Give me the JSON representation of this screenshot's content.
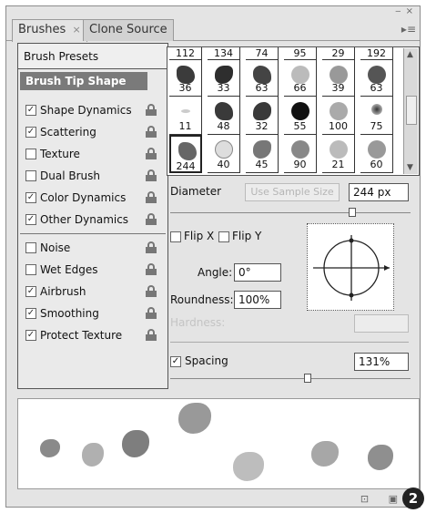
{
  "tabs": [
    {
      "label": "Brushes",
      "close": "×"
    },
    {
      "label": "Clone Source"
    }
  ],
  "window_controls": "‒ ×",
  "panel_menu_icon": "list-icon",
  "left": {
    "presets": "Brush Presets",
    "tip_shape": "Brush Tip Shape",
    "options": [
      {
        "label": "Shape Dynamics",
        "checked": true
      },
      {
        "label": "Scattering",
        "checked": true
      },
      {
        "label": "Texture",
        "checked": false
      },
      {
        "label": "Dual Brush",
        "checked": false
      },
      {
        "label": "Color Dynamics",
        "checked": true
      },
      {
        "label": "Other Dynamics",
        "checked": true
      },
      {
        "label": "Noise",
        "checked": false
      },
      {
        "label": "Wet Edges",
        "checked": false
      },
      {
        "label": "Airbrush",
        "checked": true
      },
      {
        "label": "Smoothing",
        "checked": true
      },
      {
        "label": "Protect Texture",
        "checked": true
      }
    ]
  },
  "brush_grid": {
    "top_row": [
      "112",
      "134",
      "74",
      "95",
      "29",
      "192"
    ],
    "row1": [
      "36",
      "33",
      "63",
      "66",
      "39",
      "63"
    ],
    "row2": [
      "11",
      "48",
      "32",
      "55",
      "100",
      "75"
    ],
    "row3": [
      "244",
      "40",
      "45",
      "90",
      "21",
      "60"
    ],
    "selected": "244"
  },
  "diameter": {
    "label": "Diameter",
    "button": "Use Sample Size",
    "value": "244 px"
  },
  "flip_x": {
    "label": "Flip X",
    "checked": false
  },
  "flip_y": {
    "label": "Flip Y",
    "checked": false
  },
  "angle": {
    "label": "Angle:",
    "value": "0°"
  },
  "roundness": {
    "label": "Roundness:",
    "value": "100%"
  },
  "hardness": {
    "label": "Hardness:"
  },
  "spacing": {
    "label": "Spacing",
    "checked": true,
    "value": "131%"
  },
  "badge": "2",
  "colors": {
    "selected": "#7a7a7a",
    "panel": "#e4e4e4"
  }
}
